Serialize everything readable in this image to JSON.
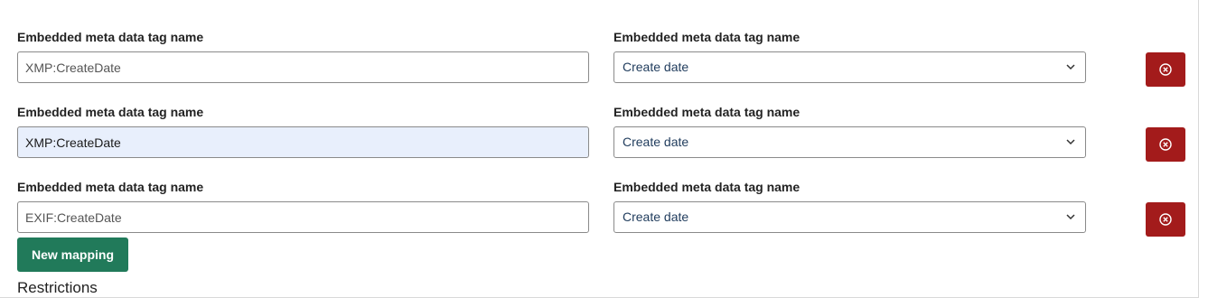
{
  "mappings": [
    {
      "left_label": "Embedded meta data tag name",
      "left_value": "XMP:CreateDate",
      "right_label": "Embedded meta data tag name",
      "right_value": "Create date"
    },
    {
      "left_label": "Embedded meta data tag name",
      "left_value": "XMP:CreateDate",
      "right_label": "Embedded meta data tag name",
      "right_value": "Create date"
    },
    {
      "left_label": "Embedded meta data tag name",
      "left_value": "EXIF:CreateDate",
      "right_label": "Embedded meta data tag name",
      "right_value": "Create date"
    }
  ],
  "new_mapping_label": "New mapping",
  "next_section_heading": "Restrictions",
  "colors": {
    "delete_button": "#a31b1b",
    "primary_button": "#217a5a",
    "autofill_background": "#e8effc"
  },
  "icons": {
    "delete": "close-circle-icon",
    "select": "chevron-down-icon"
  }
}
